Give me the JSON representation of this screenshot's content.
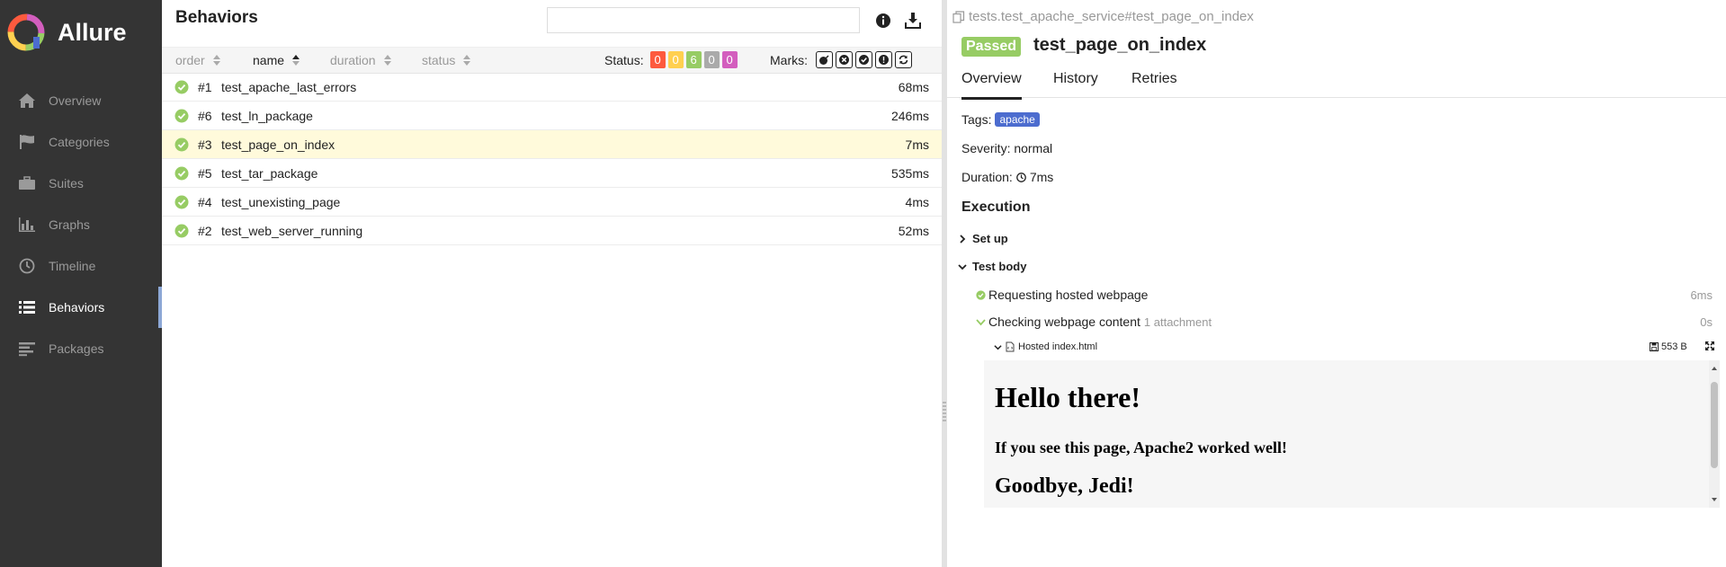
{
  "app": {
    "name": "Allure",
    "colors": {
      "sidebar_bg": "#343434",
      "active_indicator": "#8da8d6",
      "passed": "#97cc64",
      "tag": "#4c6ccf",
      "selected_row": "#fffadb"
    }
  },
  "sidebar": {
    "items": [
      {
        "label": "Overview",
        "icon": "home-icon",
        "active": false
      },
      {
        "label": "Categories",
        "icon": "flag-icon",
        "active": false
      },
      {
        "label": "Suites",
        "icon": "briefcase-icon",
        "active": false
      },
      {
        "label": "Graphs",
        "icon": "bar-chart-icon",
        "active": false
      },
      {
        "label": "Timeline",
        "icon": "clock-icon",
        "active": false
      },
      {
        "label": "Behaviors",
        "icon": "list-icon",
        "active": true
      },
      {
        "label": "Packages",
        "icon": "align-left-icon",
        "active": false
      }
    ]
  },
  "behaviors": {
    "title": "Behaviors",
    "search_value": "",
    "columns": [
      "order",
      "name",
      "duration",
      "status"
    ],
    "active_sort": "name",
    "status_label": "Status:",
    "status_counts": [
      {
        "value": "0",
        "color": "#fd5a3e",
        "kind": "failed"
      },
      {
        "value": "0",
        "color": "#ffd050",
        "kind": "broken"
      },
      {
        "value": "6",
        "color": "#97cc64",
        "kind": "passed"
      },
      {
        "value": "0",
        "color": "#aaaaaa",
        "kind": "skipped"
      },
      {
        "value": "0",
        "color": "#d35ebe",
        "kind": "unknown"
      }
    ],
    "marks_label": "Marks:",
    "marks": [
      "bomb-icon",
      "times-circle-icon",
      "check-circle-icon",
      "exclamation-icon",
      "retry-icon"
    ],
    "rows": [
      {
        "num": "#1",
        "name": "test_apache_last_errors",
        "duration": "68ms",
        "selected": false
      },
      {
        "num": "#6",
        "name": "test_ln_package",
        "duration": "246ms",
        "selected": false
      },
      {
        "num": "#3",
        "name": "test_page_on_index",
        "duration": "7ms",
        "selected": true
      },
      {
        "num": "#5",
        "name": "test_tar_package",
        "duration": "535ms",
        "selected": false
      },
      {
        "num": "#4",
        "name": "test_unexisting_page",
        "duration": "4ms",
        "selected": false
      },
      {
        "num": "#2",
        "name": "test_web_server_running",
        "duration": "52ms",
        "selected": false
      }
    ]
  },
  "detail": {
    "breadcrumb": "tests.test_apache_service#test_page_on_index",
    "status": "Passed",
    "title": "test_page_on_index",
    "tabs": [
      "Overview",
      "History",
      "Retries"
    ],
    "active_tab": "Overview",
    "tags_label": "Tags:",
    "tag": "apache",
    "severity": "Severity: normal",
    "duration_label": "Duration:",
    "duration": "7ms",
    "execution_title": "Execution",
    "setup_label": "Set up",
    "body_label": "Test body",
    "steps": [
      {
        "name": "Requesting hosted webpage",
        "duration": "6ms"
      },
      {
        "name": "Checking webpage content",
        "attachments": "1 attachment",
        "duration": "0s"
      }
    ],
    "attachment": {
      "name": "Hosted index.html",
      "size": "553 B"
    },
    "preview": {
      "heading": "Hello there!",
      "paragraph": "If you see this page, Apache2 worked well!",
      "closing": "Goodbye, Jedi!"
    }
  }
}
